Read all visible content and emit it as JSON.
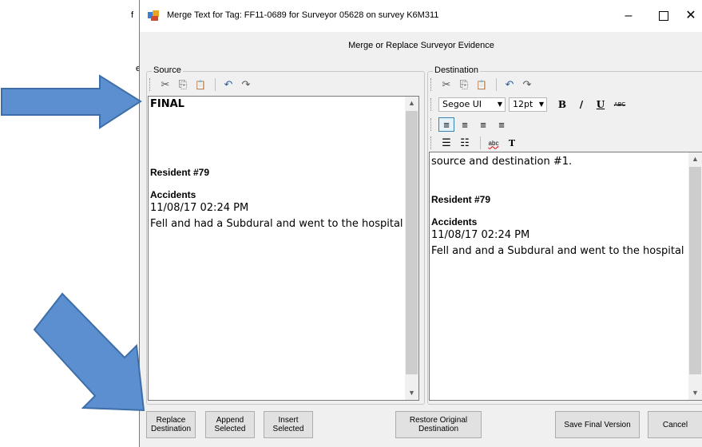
{
  "background": {
    "edge_char_1": "f",
    "edge_char_2": "er"
  },
  "window": {
    "title": "Merge Text for Tag: FF11-0689 for Surveyor 05628 on survey K6M311",
    "controls": {
      "minimize": "–",
      "maximize": "",
      "close": "✕"
    }
  },
  "header": {
    "label": "Merge or Replace Surveyor Evidence"
  },
  "source": {
    "group_label": "Source",
    "toolbar": {
      "cut": "✂",
      "copy": "⎘",
      "paste": "📋",
      "undo": "↶",
      "redo": "↷"
    },
    "lines": {
      "final": "FINAL",
      "resident": "Resident #79",
      "accidents": "Accidents",
      "date": "11/08/17 02:24 PM",
      "note": "Fell and had a Subdural and went to the hospital"
    }
  },
  "destination": {
    "group_label": "Destination",
    "toolbar": {
      "cut": "✂",
      "copy": "⎘",
      "paste": "📋",
      "undo": "↶",
      "redo": "↷"
    },
    "format": {
      "font": "Segoe UI",
      "size": "12pt",
      "bold": "B",
      "italic": "/",
      "underline": "U",
      "strike": "ABC",
      "align_left": "≡",
      "align_center": "≡",
      "align_right": "≡",
      "justify": "≡",
      "bullets": "☰",
      "numbers": "☷",
      "spell": "abc",
      "text": "T"
    },
    "lines": {
      "first": "source and destination #1.",
      "resident": "Resident #79",
      "accidents": "Accidents",
      "date": "11/08/17 02:24 PM",
      "note": "Fell and and a Subdural and went to the hospital"
    }
  },
  "buttons": {
    "replace": "Replace Destination",
    "append": "Append Selected",
    "insert": "Insert Selected",
    "restore": "Restore Original Destination",
    "save": "Save Final Version",
    "cancel": "Cancel"
  },
  "colors": {
    "arrow": "#5b8fd0",
    "arrow_outline": "#3e6ea8",
    "window_bg": "#f0f0f0"
  }
}
